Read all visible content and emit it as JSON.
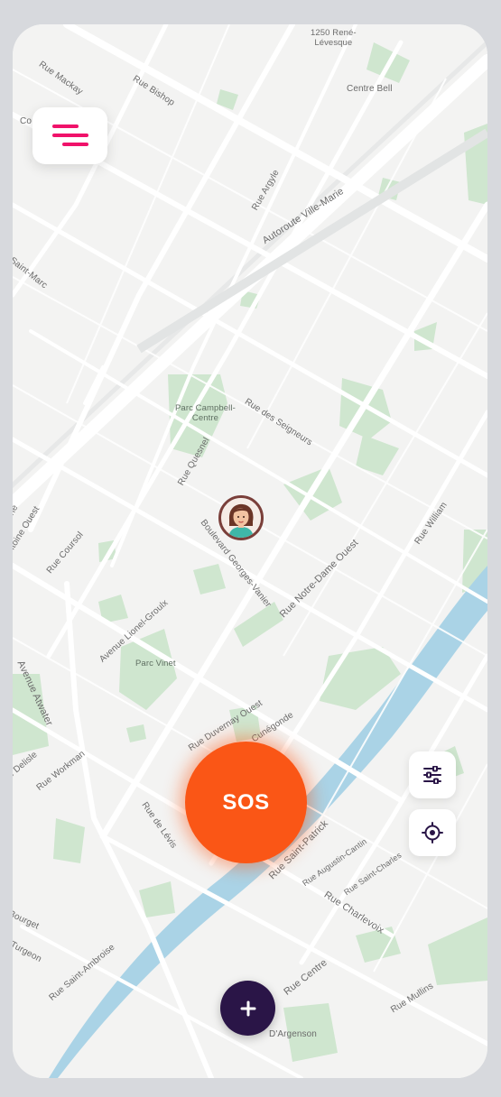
{
  "map": {
    "street_labels": [
      {
        "id": "rene-levesque",
        "text": "1250 René-\nLévesque"
      },
      {
        "id": "rue-mackay",
        "text": "Rue Mackay"
      },
      {
        "id": "rue-bishop",
        "text": "Rue Bishop"
      },
      {
        "id": "centre-bell",
        "text": "Centre Bell"
      },
      {
        "id": "co",
        "text": "Co"
      },
      {
        "id": "rue-argyle",
        "text": "Rue Argyle"
      },
      {
        "id": "autoroute-ville-marie",
        "text": "Autoroute Ville-Marie"
      },
      {
        "id": "saint-marc",
        "text": "Saint-Marc"
      },
      {
        "id": "rue-des-seigneurs",
        "text": "Rue des Seigneurs"
      },
      {
        "id": "rue-quesnel",
        "text": "Rue Quesnel"
      },
      {
        "id": "rie",
        "text": "rie"
      },
      {
        "id": "antoine-ouest",
        "text": "t-Antoine Ouest"
      },
      {
        "id": "rue-coursol",
        "text": "Rue Coursol"
      },
      {
        "id": "blvd-georges-vanier",
        "text": "Boulevard Georges-Vanier"
      },
      {
        "id": "rue-notre-dame-ouest",
        "text": "Rue Notre-Dame Ouest"
      },
      {
        "id": "rue-william",
        "text": "Rue William"
      },
      {
        "id": "avenue-lionel-groulx",
        "text": "Avenue Lionel-Groulx"
      },
      {
        "id": "avenue-atwater",
        "text": "Avenue Atwater"
      },
      {
        "id": "rue-duvernay-ouest",
        "text": "Rue Duvernay Ouest"
      },
      {
        "id": "cunegonde",
        "text": "Cunégonde"
      },
      {
        "id": "delisle",
        "text": "e Delisle"
      },
      {
        "id": "rue-workman",
        "text": "Rue Workman"
      },
      {
        "id": "rue-de-levis",
        "text": "Rue de Lévis"
      },
      {
        "id": "rue-saint-patrick",
        "text": "Rue Saint-Patrick"
      },
      {
        "id": "rue-augustin-cantin",
        "text": "Rue Augustin-Cantin"
      },
      {
        "id": "rue-saint-charles",
        "text": "Rue Saint-Charles"
      },
      {
        "id": "rue-charlevoix",
        "text": "Rue Charlevoix"
      },
      {
        "id": "bourget",
        "text": "Bourget"
      },
      {
        "id": "turgeon",
        "text": "Turgeon"
      },
      {
        "id": "rue-saint-ambroise",
        "text": "Rue Saint-Ambroise"
      },
      {
        "id": "rue-centre",
        "text": "Rue Centre"
      },
      {
        "id": "rue-mullins",
        "text": "Rue Mullins"
      },
      {
        "id": "d-argenson",
        "text": "D'Argenson"
      }
    ],
    "park_labels": [
      {
        "id": "parc-campbell",
        "text": "Parc Campbell-\nCentre"
      },
      {
        "id": "parc-vinet",
        "text": "Parc Vinet"
      }
    ]
  },
  "sos_button": {
    "label": "SOS"
  },
  "icons": {
    "menu": "menu-icon",
    "filters": "sliders-icon",
    "locate": "crosshair-icon",
    "add": "plus-icon",
    "avatar": "user-avatar"
  },
  "colors": {
    "accent": "#fa5616",
    "menu_accent": "#f0126a",
    "add_button": "#2a1547",
    "park": "#cfe6cf",
    "water": "#aad3e6",
    "road": "#ffffff",
    "land": "#f3f3f2"
  }
}
